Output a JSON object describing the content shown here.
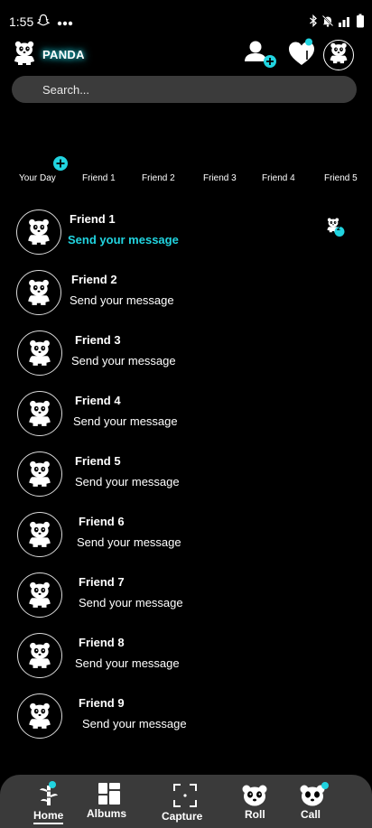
{
  "status_bar": {
    "time": "1:55",
    "left_icons": [
      "snapchat-ghost-icon",
      "more-dots-icon"
    ],
    "right_icons": [
      "bluetooth-icon",
      "bell-muted-icon",
      "signal-icon",
      "battery-icon"
    ]
  },
  "header": {
    "app_name": "PANDA",
    "logo_icon": "panda-logo-icon",
    "actions": [
      "add-friend-icon",
      "heart-icon",
      "profile-panda-icon"
    ]
  },
  "search": {
    "placeholder": "Search..."
  },
  "stories": [
    {
      "label": "Your Day"
    },
    {
      "label": "Friend 1"
    },
    {
      "label": "Friend 2"
    },
    {
      "label": "Friend 3"
    },
    {
      "label": "Friend 4"
    },
    {
      "label": "Friend 5"
    }
  ],
  "chats": [
    {
      "name": "Friend 1",
      "message": "Send your message",
      "unread": true
    },
    {
      "name": "Friend 2",
      "message": "Send your message",
      "unread": false
    },
    {
      "name": "Friend 3",
      "message": "Send your message",
      "unread": false
    },
    {
      "name": "Friend 4",
      "message": "Send your message",
      "unread": false
    },
    {
      "name": "Friend 5",
      "message": "Send your message",
      "unread": false
    },
    {
      "name": "Friend 6",
      "message": "Send your message",
      "unread": false
    },
    {
      "name": "Friend 7",
      "message": "Send your message",
      "unread": false
    },
    {
      "name": "Friend 8",
      "message": "Send your message",
      "unread": false
    },
    {
      "name": "Friend 9",
      "message": "Send your message",
      "unread": false
    }
  ],
  "unread_badge": {
    "count": "2",
    "icon": "panda-notification-icon"
  },
  "bottom_nav": [
    {
      "label": "Home",
      "icon": "bamboo-icon",
      "active": true
    },
    {
      "label": "Albums",
      "icon": "grid-icon",
      "active": false
    },
    {
      "label": "Capture",
      "icon": "camera-frame-icon",
      "active": false
    },
    {
      "label": "Roll",
      "icon": "panda-face-icon",
      "active": false
    },
    {
      "label": "Call",
      "icon": "panda-call-icon",
      "active": false
    }
  ],
  "colors": {
    "accent": "#21d4e0",
    "background": "#000000",
    "surface": "#3a3a3a",
    "search_bg": "#3b3b3b"
  }
}
